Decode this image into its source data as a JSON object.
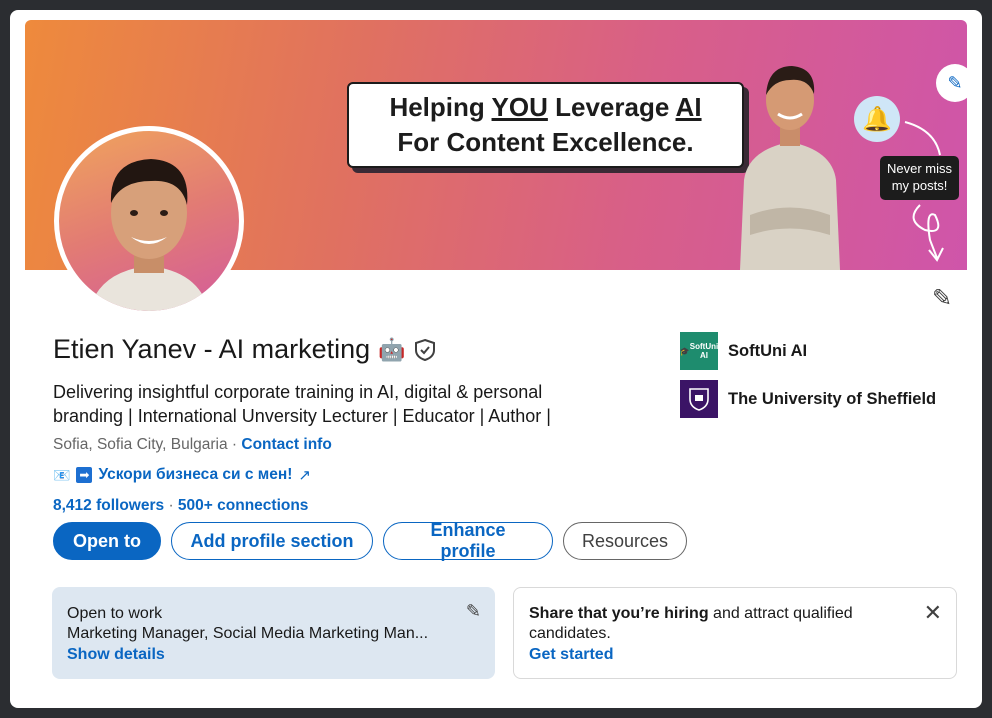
{
  "banner": {
    "line1_pre": "Helping ",
    "line1_you": "YOU",
    "line1_mid": " Leverage ",
    "line1_ai": "AI",
    "line2": "For Content Excellence.",
    "callout_line1": "Never miss",
    "callout_line2": "my posts!"
  },
  "profile": {
    "name": "Etien Yanev - AI marketing",
    "headline": "Delivering insightful corporate training in AI, digital & personal branding | International Unversity Lecturer | Educator | Author |",
    "location": "Sofia, Sofia City, Bulgaria",
    "location_sep": " · ",
    "contact_info": "Contact info",
    "website": "Ускори бизнеса си с мен!",
    "followers": "8,412 followers",
    "connections_sep": " · ",
    "connections": "500+ connections"
  },
  "actions": {
    "open_to": "Open to",
    "add_section": "Add profile section",
    "enhance": "Enhance profile",
    "resources": "Resources"
  },
  "orgs": [
    {
      "name": "SoftUni AI",
      "logo_text": "SoftUni AI",
      "color": "#1e8c6e"
    },
    {
      "name": "The University of Sheffield",
      "color": "#3b1466"
    }
  ],
  "open_to_work": {
    "title": "Open to work",
    "roles": "Marketing Manager, Social Media Marketing Man...",
    "link": "Show details"
  },
  "hiring": {
    "bold": "Share that you’re hiring",
    "rest": " and attract qualified candidates.",
    "link": "Get started"
  },
  "icons": {
    "banner_edit": "pencil-icon",
    "profile_edit": "pencil-icon",
    "verified": "shield-check-icon",
    "robot": "robot-icon",
    "external": "external-link-icon",
    "close": "close-icon"
  },
  "colors": {
    "brand": "#0a66c2",
    "otw_bg": "#dde7f1"
  }
}
